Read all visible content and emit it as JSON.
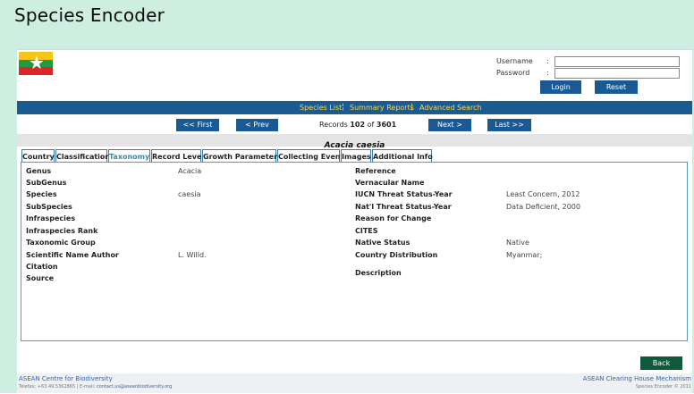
{
  "app_title": "Species Encoder",
  "flag": {
    "country": "Myanmar",
    "colors": {
      "yellow": "#f5c518",
      "green": "#1f9a3e",
      "red": "#e0242c",
      "star": "#ffffff"
    },
    "star_glyph": "★"
  },
  "login": {
    "username_label": "Username",
    "password_label": "Password",
    "colon": ":",
    "username_value": "",
    "password_value": "",
    "login_button": "Login",
    "reset_button": "Reset"
  },
  "nav": {
    "items": [
      "Species List",
      "Summary Reports",
      "Advanced Search"
    ],
    "separator": "¦"
  },
  "pager": {
    "first": "<< First",
    "prev": "< Prev",
    "next": "Next >",
    "last": "Last >>",
    "records_prefix": "Records",
    "current": "102",
    "of": "of",
    "total": "3601"
  },
  "species_name": "Acacia caesia",
  "tabs": [
    "Country",
    "Classification",
    "Taxonomy",
    "Record Level",
    "Growth Parameters",
    "Collecting Event",
    "Images",
    "Additional Info"
  ],
  "active_tab": "Taxonomy",
  "left_fields": [
    {
      "label": "Genus",
      "value": "Acacia"
    },
    {
      "label": "SubGenus",
      "value": ""
    },
    {
      "label": "Species",
      "value": "caesia"
    },
    {
      "label": "SubSpecies",
      "value": ""
    },
    {
      "label": "Infraspecies",
      "value": ""
    },
    {
      "label": "Infraspecies Rank",
      "value": ""
    },
    {
      "label": "Taxonomic Group",
      "value": ""
    },
    {
      "label": "Scientific Name Author",
      "value": "L. Willd."
    },
    {
      "label": "Citation",
      "value": ""
    },
    {
      "label": "Source",
      "value": ""
    }
  ],
  "right_fields": [
    {
      "label": "Reference",
      "value": ""
    },
    {
      "label": "Vernacular Name",
      "value": ""
    },
    {
      "label": "IUCN Threat Status-Year",
      "value": "Least Concern, 2012"
    },
    {
      "label": "Nat'l Threat Status-Year",
      "value": "Data Deficient, 2000"
    },
    {
      "label": "Reason for Change",
      "value": ""
    },
    {
      "label": "CITES",
      "value": ""
    },
    {
      "label": "Native Status",
      "value": "Native"
    },
    {
      "label": "Country Distribution",
      "value": "Myanmar;"
    },
    {
      "label": "Description",
      "value": ""
    }
  ],
  "back_button": "Back",
  "footer": {
    "org_name": "ASEAN Centre for Biodiversity",
    "contact": "Telefax: +63.49.5362865 | E-mail:",
    "email": "contact.us@aseanbiodiversity.org",
    "right_title": "ASEAN Clearing House Mechanism",
    "copyright": "Species Encoder © 2011"
  },
  "colors": {
    "frame_bg": "#cdeee0",
    "nav_bg": "#1a5b92",
    "nav_link": "#ffd84a",
    "button_blue": "#1a5a94",
    "back_button": "#0e5a3a",
    "tab_active_text": "#3d86ab",
    "footer_link": "#3463a8"
  }
}
